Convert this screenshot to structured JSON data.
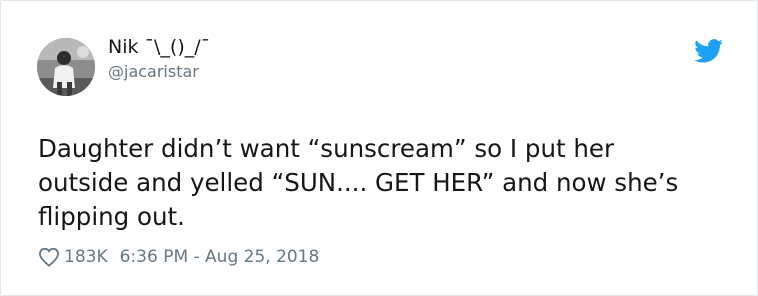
{
  "user": {
    "display_name": "Nik ¯\\_()_/¯",
    "handle": "@jacaristar"
  },
  "tweet": {
    "text_lines": [
      "Daughter didn’t want “sunscream” so I put her",
      "outside and yelled “SUN.... GET HER” and now she’s",
      "flipping out."
    ],
    "likes": "183K",
    "timestamp": "6:36 PM - Aug 25, 2018"
  },
  "icons": {
    "logo": "twitter-bird-icon",
    "like": "heart-icon"
  },
  "colors": {
    "brand": "#1da1f2",
    "text": "#14171a",
    "muted": "#657786"
  }
}
